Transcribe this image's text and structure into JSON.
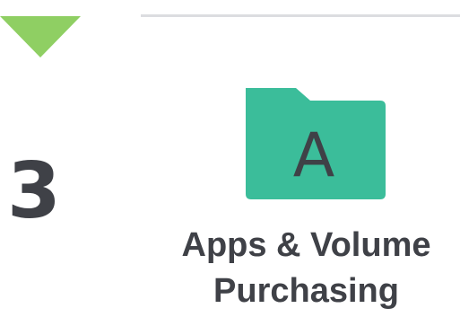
{
  "step": {
    "number": "3"
  },
  "item": {
    "icon": "folder-letter-a-icon",
    "icon_letter": "A",
    "label_line1": "Apps & Volume",
    "label_line2": "Purchasing"
  },
  "colors": {
    "arrow": "#8fcf63",
    "folder": "#3bbd9a",
    "text": "#3f4147",
    "divider": "#dcdde0"
  }
}
